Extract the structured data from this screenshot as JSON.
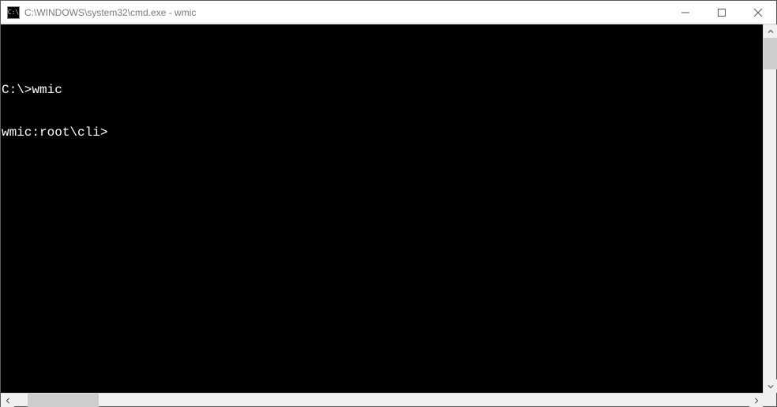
{
  "window": {
    "title": "C:\\WINDOWS\\system32\\cmd.exe - wmic",
    "icon_glyph": "C:\\"
  },
  "terminal": {
    "lines": [
      "",
      "C:\\>wmic",
      "wmic:root\\cli>"
    ]
  },
  "colors": {
    "terminal_bg": "#000000",
    "terminal_fg": "#ffffff",
    "titlebar_bg": "#ffffff",
    "titlebar_fg": "#7a7a7a"
  }
}
